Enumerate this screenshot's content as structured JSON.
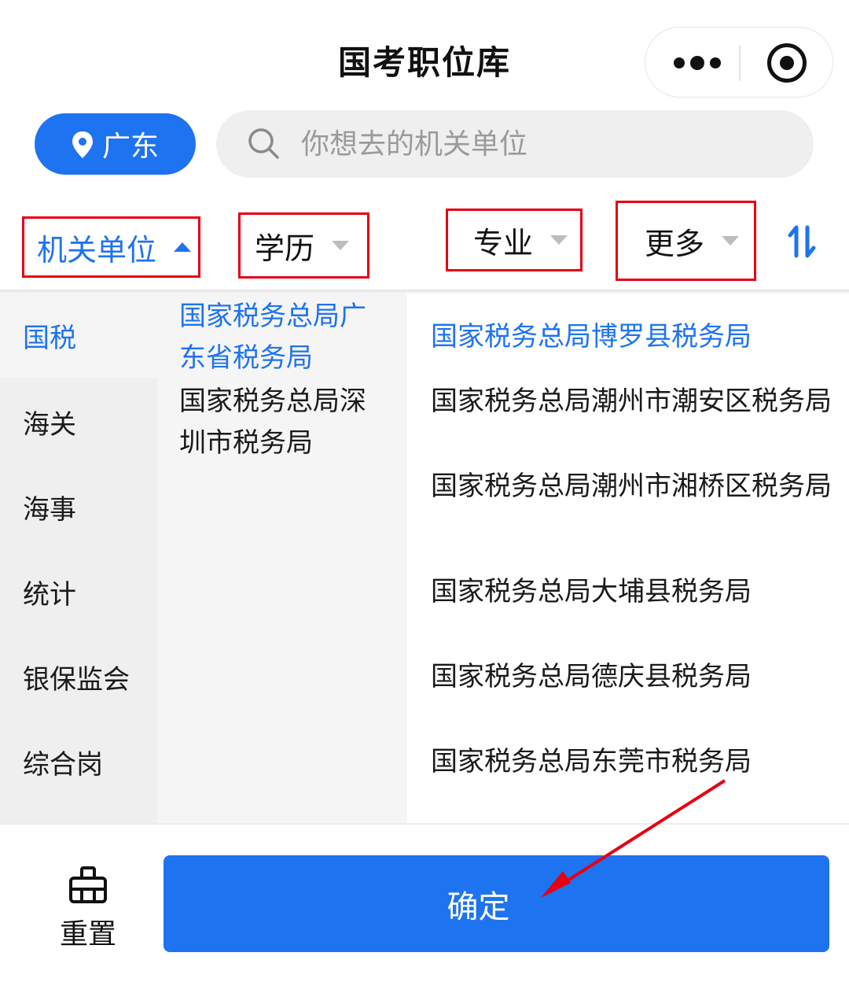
{
  "nav": {
    "title": "国考职位库"
  },
  "location": {
    "label": "广东"
  },
  "search": {
    "placeholder": "你想去的机关单位"
  },
  "filters": [
    {
      "label": "机关单位",
      "active": true
    },
    {
      "label": "学历",
      "active": false
    },
    {
      "label": "专业",
      "active": false
    },
    {
      "label": "更多",
      "active": false
    }
  ],
  "sort": {
    "icon": "sort-icon"
  },
  "categories": [
    "国税",
    "海关",
    "海事",
    "统计",
    "银保监会",
    "综合岗"
  ],
  "active_category": "国税",
  "subunits": [
    "国家税务总局广东省税务局",
    "国家税务总局深圳市税务局"
  ],
  "active_subunit": "国家税务总局广东省税务局",
  "offices": [
    "国家税务总局博罗县税务局",
    "国家税务总局潮州市潮安区税务局",
    "国家税务总局潮州市湘桥区税务局",
    "国家税务总局大埔县税务局",
    "国家税务总局德庆县税务局",
    "国家税务总局东莞市税务局"
  ],
  "active_office": "国家税务总局博罗县税务局",
  "footer": {
    "reset_label": "重置",
    "confirm_label": "确定"
  },
  "colors": {
    "accent": "#1e73f0",
    "annotation": "#e60012"
  }
}
